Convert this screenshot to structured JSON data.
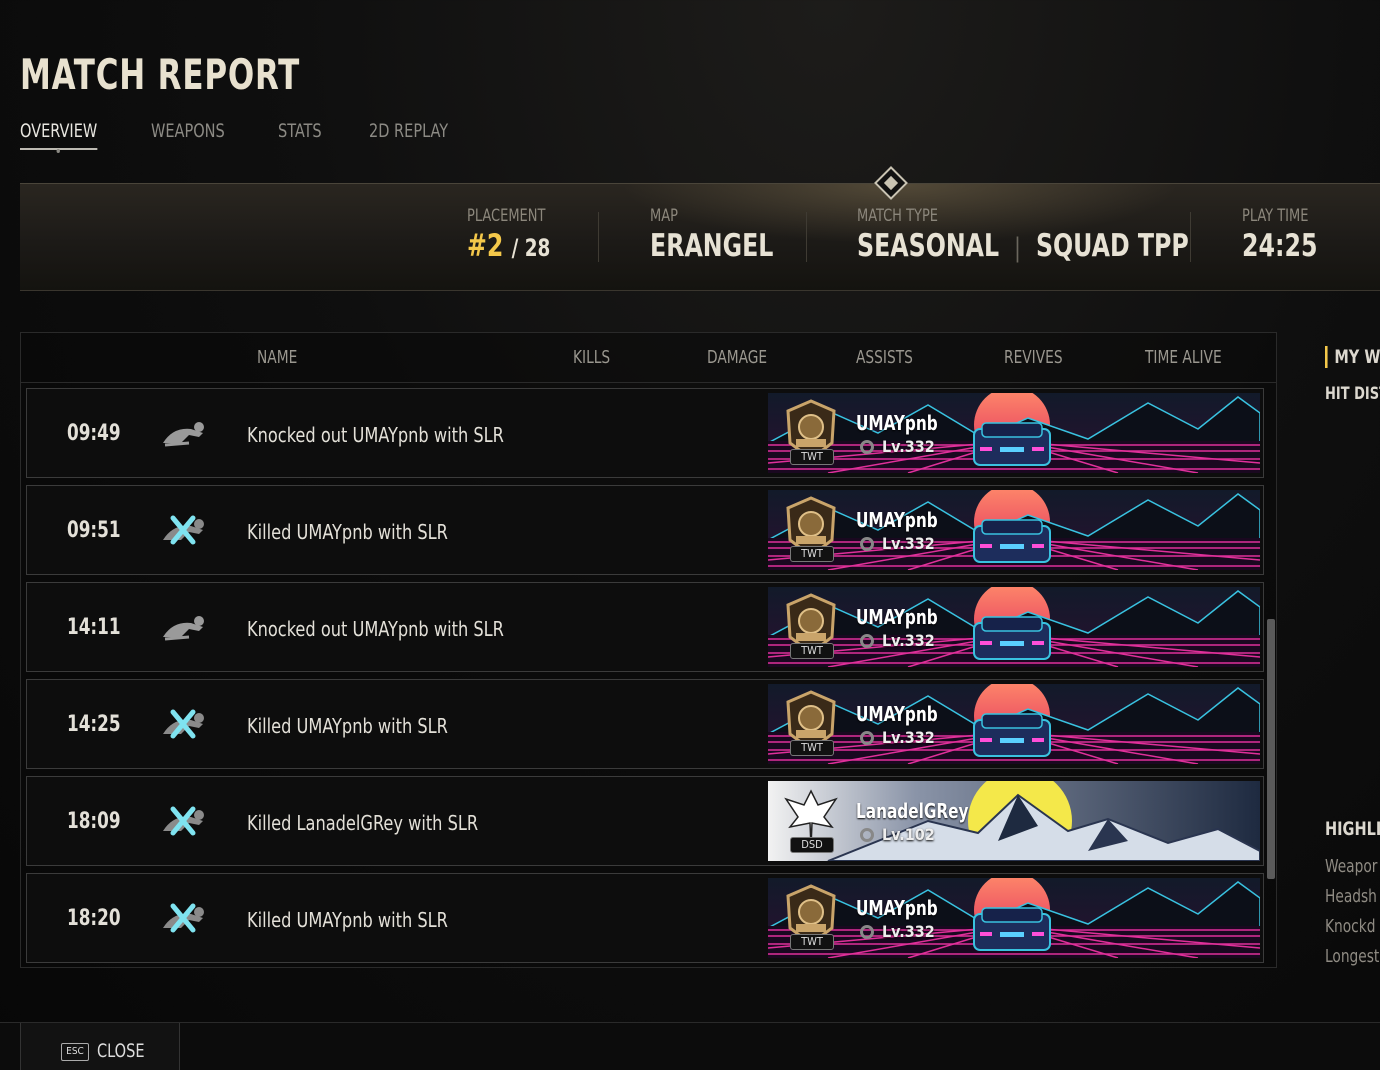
{
  "header": {
    "title": "MATCH REPORT",
    "tabs": [
      {
        "label": "OVERVIEW",
        "active": true
      },
      {
        "label": "WEAPONS",
        "active": false
      },
      {
        "label": "STATS",
        "active": false
      },
      {
        "label": "2D REPLAY",
        "active": false
      }
    ]
  },
  "summary": {
    "placement_label": "PLACEMENT",
    "placement_rank": "#2",
    "placement_total": "/ 28",
    "map_label": "MAP",
    "map_value": "ERANGEL",
    "match_type_label": "MATCH TYPE",
    "match_type_value": "SEASONAL",
    "match_mode_value": "SQUAD TPP",
    "play_time_label": "PLAY TIME",
    "play_time_value": "24:25"
  },
  "table": {
    "columns": [
      "NAME",
      "KILLS",
      "DAMAGE",
      "ASSISTS",
      "REVIVES",
      "TIME ALIVE"
    ],
    "events": [
      {
        "time": "09:49",
        "icon": "knockdown-icon",
        "text": "Knocked out UMAYpnb with SLR",
        "victim": "UMAYpnb",
        "level": "Lv.332",
        "clan": "TWT",
        "card": "synthwave"
      },
      {
        "time": "09:51",
        "icon": "kill-icon",
        "text": "Killed UMAYpnb with SLR",
        "victim": "UMAYpnb",
        "level": "Lv.332",
        "clan": "TWT",
        "card": "synthwave"
      },
      {
        "time": "14:11",
        "icon": "knockdown-icon",
        "text": "Knocked out UMAYpnb with SLR",
        "victim": "UMAYpnb",
        "level": "Lv.332",
        "clan": "TWT",
        "card": "synthwave"
      },
      {
        "time": "14:25",
        "icon": "kill-icon",
        "text": "Killed UMAYpnb with SLR",
        "victim": "UMAYpnb",
        "level": "Lv.332",
        "clan": "TWT",
        "card": "synthwave"
      },
      {
        "time": "18:09",
        "icon": "kill-icon",
        "text": "Killed LanadelGRey with SLR",
        "victim": "LanadelGRey",
        "level": "Lv.102",
        "clan": "DSD",
        "card": "mountain"
      },
      {
        "time": "18:20",
        "icon": "kill-icon",
        "text": "Killed UMAYpnb with SLR",
        "victim": "UMAYpnb",
        "level": "Lv.332",
        "clan": "TWT",
        "card": "synthwave"
      }
    ]
  },
  "right_panel": {
    "heading": "MY W",
    "subheading": "HIT DIST",
    "highlights_heading": "HIGHLIGI",
    "highlights_items": [
      "Weapor",
      "Headsh",
      "Knockd",
      "Longest"
    ]
  },
  "footer": {
    "esc_key": "ESC",
    "close_label": "CLOSE"
  },
  "colors": {
    "accent_gold": "#f4c84a",
    "kill_x": "#7fe3f0",
    "synthwave_pink": "#e0309a",
    "synthwave_sun": "#ff6f5e"
  }
}
